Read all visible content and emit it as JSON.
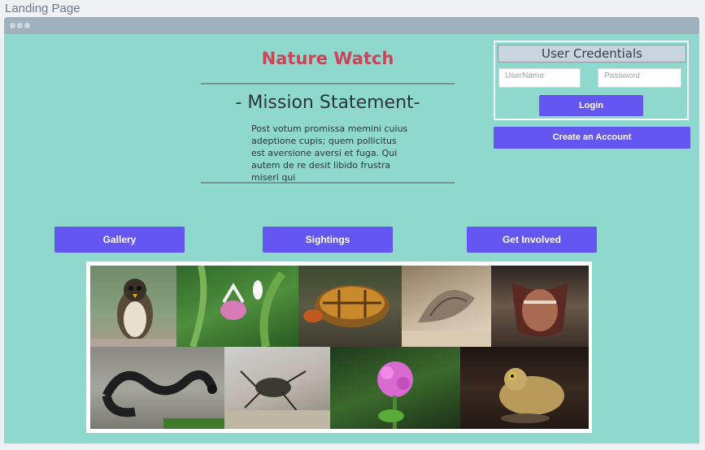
{
  "page_label": "Landing Page",
  "header": {
    "title": "Nature Watch"
  },
  "mission": {
    "heading": "- Mission Statement-",
    "body": "Post votum promissa memini cuius adeptione cupis; quem pollicitus est aversione aversi et fuga. Qui autem de re desit libido frustra miseri qui"
  },
  "credentials": {
    "title": "User Credentials",
    "username_placeholder": "UserName",
    "password_placeholder": "Password",
    "login_label": "Login",
    "create_account_label": "Create an Account"
  },
  "nav": {
    "items": [
      {
        "label": "Gallery"
      },
      {
        "label": "Sightings"
      },
      {
        "label": "Get Involved"
      }
    ]
  },
  "gallery": {
    "images": [
      {
        "subject": "falcon"
      },
      {
        "subject": "lady-slipper-orchid"
      },
      {
        "subject": "box-turtle"
      },
      {
        "subject": "moth"
      },
      {
        "subject": "bat"
      },
      {
        "subject": "snake"
      },
      {
        "subject": "tiger-beetle"
      },
      {
        "subject": "pink-wildflower"
      },
      {
        "subject": "toad"
      }
    ]
  },
  "colors": {
    "canvas": "#8fd8ce",
    "accent_button": "#6456f0",
    "title_red": "#cc4455"
  }
}
